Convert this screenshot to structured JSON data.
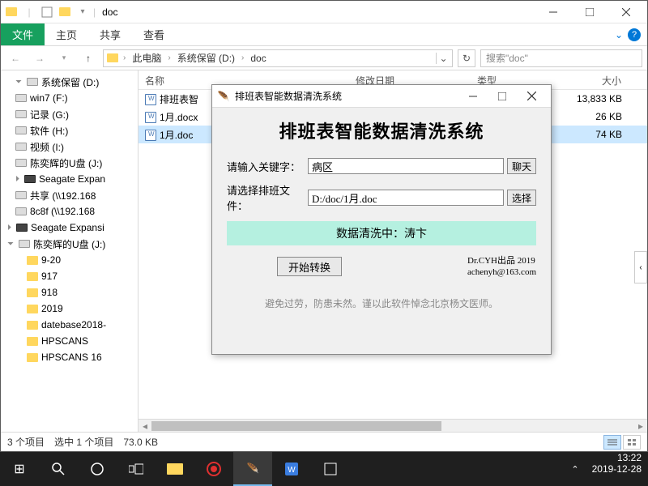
{
  "explorer": {
    "title": "doc",
    "tabs": {
      "file": "文件",
      "home": "主页",
      "share": "共享",
      "view": "查看"
    },
    "breadcrumb": [
      "此电脑",
      "系统保留 (D:)",
      "doc"
    ],
    "search_placeholder": "搜索\"doc\"",
    "columns": {
      "name": "名称",
      "date": "修改日期",
      "type": "类型",
      "size": "大小"
    },
    "tree": [
      {
        "label": "系统保留 (D:)",
        "icon": "drive",
        "indent": 0,
        "exp": "expd"
      },
      {
        "label": "win7 (F:)",
        "icon": "drive",
        "indent": 0
      },
      {
        "label": "记录 (G:)",
        "icon": "drive",
        "indent": 0
      },
      {
        "label": "软件 (H:)",
        "icon": "drive",
        "indent": 0
      },
      {
        "label": "视频 (I:)",
        "icon": "drive",
        "indent": 0
      },
      {
        "label": "陈奕辉的U盘 (J:)",
        "icon": "drive",
        "indent": 0
      },
      {
        "label": "Seagate Expan",
        "icon": "drive-dark",
        "indent": 0,
        "exp": "exp"
      },
      {
        "label": "共享 (\\\\192.168",
        "icon": "drive",
        "indent": 0
      },
      {
        "label": "8c8f (\\\\192.168",
        "icon": "drive",
        "indent": 0
      },
      {
        "label": "Seagate Expansi",
        "icon": "drive-dark",
        "indent": -1,
        "exp": "exp"
      },
      {
        "label": "陈奕辉的U盘 (J:)",
        "icon": "drive",
        "indent": -1,
        "exp": "expd"
      },
      {
        "label": "9-20",
        "icon": "folder",
        "indent": 1
      },
      {
        "label": "917",
        "icon": "folder",
        "indent": 1
      },
      {
        "label": "918",
        "icon": "folder",
        "indent": 1
      },
      {
        "label": "2019",
        "icon": "folder",
        "indent": 1
      },
      {
        "label": "datebase2018-",
        "icon": "folder",
        "indent": 1
      },
      {
        "label": "HPSCANS",
        "icon": "folder",
        "indent": 1
      },
      {
        "label": "HPSCANS 16",
        "icon": "folder",
        "indent": 1
      }
    ],
    "files": [
      {
        "name": "排班表智",
        "size": "13,833 KB",
        "selected": false
      },
      {
        "name": "1月.docx",
        "size": "26 KB",
        "selected": false
      },
      {
        "name": "1月.doc",
        "size": "74 KB",
        "selected": true
      }
    ],
    "status": {
      "count": "3 个项目",
      "selected": "选中 1 个项目",
      "size": "73.0 KB"
    }
  },
  "dialog": {
    "window_title": "排班表智能数据清洗系统",
    "heading": "排班表智能数据清洗系统",
    "keyword_label": "请输入关键字：",
    "keyword_value": "病区",
    "keyword_btn": "聊天",
    "file_label": "请选择排班文件：",
    "file_value": "D:/doc/1月.doc",
    "file_btn": "选择",
    "status_text": "数据清洗中：涛卞",
    "start_btn": "开始转换",
    "credits_line1": "Dr.CYH出品 2019",
    "credits_line2": "achenyh@163.com",
    "footer": "避免过劳，防患未然。谨以此软件悼念北京杨文医师。"
  },
  "taskbar": {
    "time": "13:22",
    "date": "2019-12-28"
  }
}
